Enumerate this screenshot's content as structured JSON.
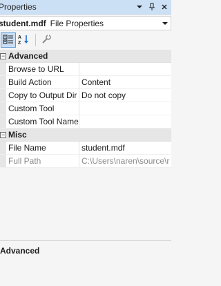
{
  "window": {
    "title": "Properties",
    "icons": [
      "chevron-down-icon",
      "pin-icon",
      "close-icon"
    ]
  },
  "object_selector": {
    "name": "student.mdf",
    "type": "File Properties"
  },
  "toolbar": {
    "buttons": [
      "categorized-icon",
      "alphabetical-icon",
      "property-pages-icon"
    ]
  },
  "categories": [
    {
      "label": "Advanced",
      "expander": "⊟",
      "properties": [
        {
          "name": "Browse to URL",
          "value": ""
        },
        {
          "name": "Build Action",
          "value": "Content"
        },
        {
          "name": "Copy to Output Dir",
          "value": "Do not copy"
        },
        {
          "name": "Custom Tool",
          "value": ""
        },
        {
          "name": "Custom Tool Name",
          "value": ""
        }
      ]
    },
    {
      "label": "Misc",
      "expander": "⊟",
      "properties": [
        {
          "name": "File Name",
          "value": "student.mdf"
        },
        {
          "name": "Full Path",
          "value": "C:\\Users\\naren\\source\\r"
        }
      ]
    }
  ],
  "description": {
    "title": "Advanced"
  }
}
